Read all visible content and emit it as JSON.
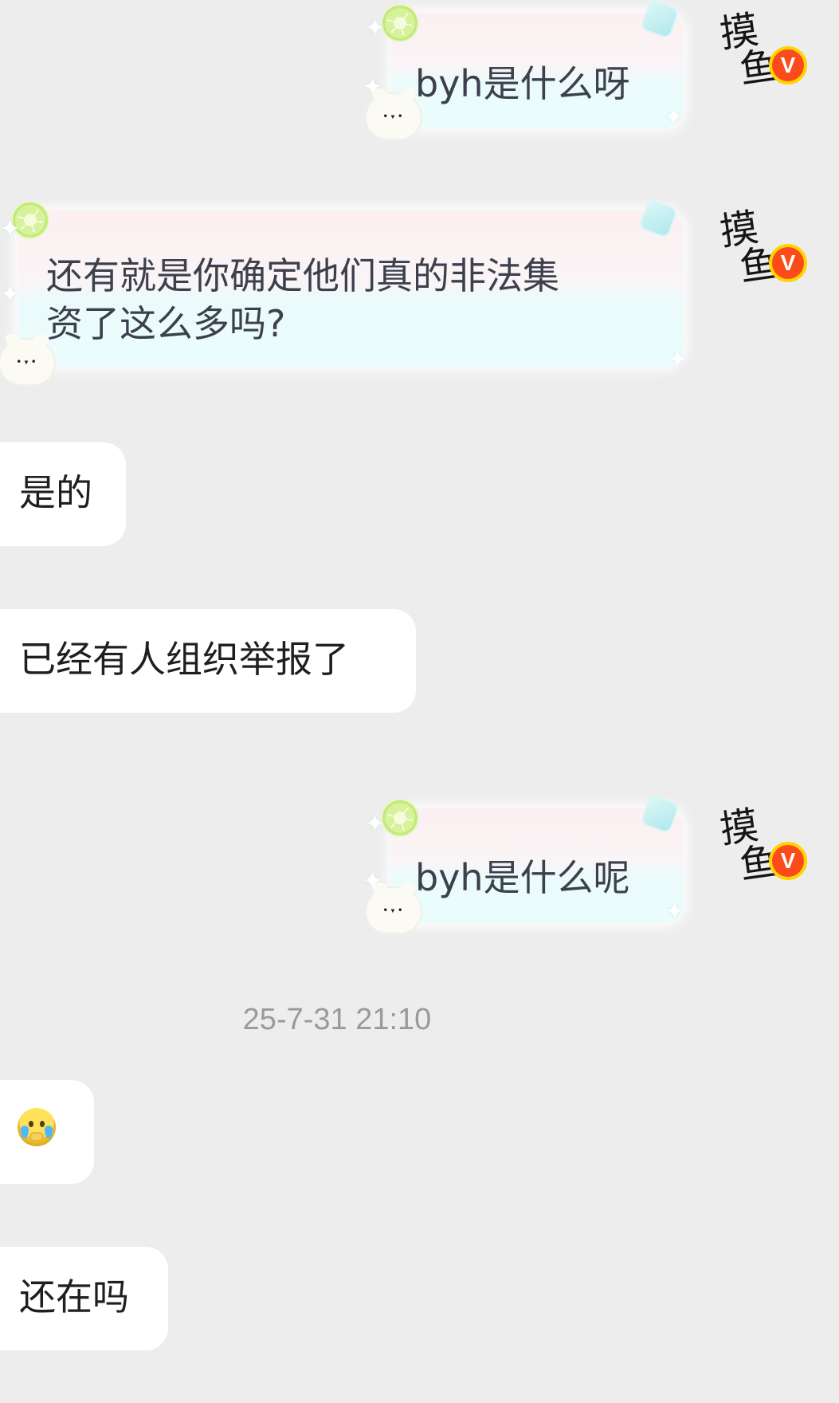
{
  "conversation": {
    "messages": [
      {
        "side": "outgoing",
        "text": "byh是什么呀"
      },
      {
        "side": "outgoing",
        "text": "还有就是你确定他们真的非法集\n资了这么多吗?"
      },
      {
        "side": "incoming",
        "text": "是的"
      },
      {
        "side": "incoming",
        "text": "已经有人组织举报了"
      },
      {
        "side": "outgoing",
        "text": "byh是什么呢"
      },
      {
        "side": "timestamp",
        "text": "25-7-31 21:10"
      },
      {
        "side": "incoming",
        "type": "emoji",
        "emoji": "crying-face-covering-mouth-icon"
      },
      {
        "side": "incoming",
        "text": "还在吗"
      }
    ]
  },
  "avatar": {
    "label": "摸鱼",
    "badge": "V",
    "badge_color": "#fb4b1b",
    "badge_ring_color": "#ffd400"
  },
  "theme": {
    "background": "#ededed",
    "incoming_bubble": "#ffffff",
    "outgoing_bubble_top": "#fcf0f1",
    "outgoing_bubble_bottom": "#eafcfb",
    "timestamp_color": "#9a9a9a"
  },
  "icons": {
    "bubble_decor": [
      "lime-icon",
      "ice-cube-icon",
      "sparkle-icon",
      "white-cat-icon"
    ],
    "verified_badge": "verified-v-badge-icon"
  }
}
